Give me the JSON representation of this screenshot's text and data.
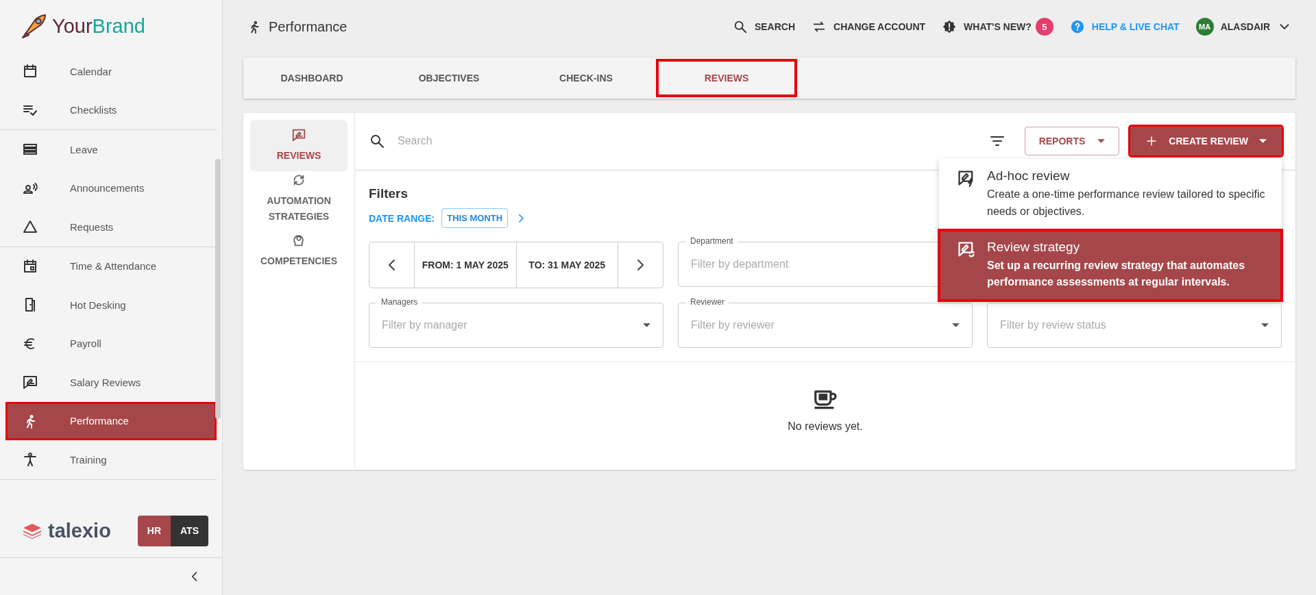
{
  "brand": {
    "part1": "Your",
    "part2": "Brand"
  },
  "sidebar": {
    "groups": [
      [
        {
          "label": "Calendar",
          "selected": false,
          "highlighted": false
        },
        {
          "label": "Checklists",
          "selected": false,
          "highlighted": false
        }
      ],
      [
        {
          "label": "Leave",
          "selected": false,
          "highlighted": false
        },
        {
          "label": "Announcements",
          "selected": false,
          "highlighted": false
        },
        {
          "label": "Requests",
          "selected": false,
          "highlighted": false
        }
      ],
      [
        {
          "label": "Time & Attendance",
          "selected": false,
          "highlighted": false
        },
        {
          "label": "Hot Desking",
          "selected": false,
          "highlighted": false
        },
        {
          "label": "Payroll",
          "selected": false,
          "highlighted": false
        },
        {
          "label": "Salary Reviews",
          "selected": false,
          "highlighted": false
        },
        {
          "label": "Performance",
          "selected": true,
          "highlighted": true
        },
        {
          "label": "Training",
          "selected": false,
          "highlighted": false
        }
      ]
    ],
    "footer": {
      "logo": "talexio",
      "modules": [
        {
          "label": "HR",
          "selected": true
        },
        {
          "label": "ATS",
          "selected": false
        }
      ]
    }
  },
  "header": {
    "title": "Performance",
    "search": "SEARCH",
    "change_account": "CHANGE ACCOUNT",
    "whats_new": "WHAT'S NEW?",
    "whats_new_count": "5",
    "help": "HELP & LIVE CHAT",
    "avatar": "MA",
    "user": "ALASDAIR"
  },
  "tabs": [
    {
      "label": "DASHBOARD",
      "selected": false,
      "highlighted": false
    },
    {
      "label": "OBJECTIVES",
      "selected": false,
      "highlighted": false
    },
    {
      "label": "CHECK-INS",
      "selected": false,
      "highlighted": false
    },
    {
      "label": "REVIEWS",
      "selected": true,
      "highlighted": true
    }
  ],
  "side_nav": [
    {
      "label": "REVIEWS",
      "selected": true
    },
    {
      "label": "AUTOMATION STRATEGIES",
      "selected": false
    },
    {
      "label": "COMPETENCIES",
      "selected": false
    }
  ],
  "toolbar": {
    "search_placeholder": "Search",
    "reports": "REPORTS",
    "create": "CREATE REVIEW",
    "create_highlighted": true
  },
  "filters": {
    "title": "Filters",
    "date_range_label": "DATE RANGE:",
    "date_range_value": "THIS MONTH",
    "from": "FROM: 1 MAY 2025",
    "to": "TO: 31 MAY 2025",
    "fields": [
      {
        "label": "Department",
        "placeholder": "Filter by department"
      },
      {
        "label": "Managers",
        "placeholder": "Filter by manager",
        "dropdown": true
      },
      {
        "label": "Reviewer",
        "placeholder": "Filter by reviewer",
        "dropdown": true
      },
      {
        "placeholder": "Filter by review status",
        "dropdown": true
      }
    ]
  },
  "empty_state": "No reviews yet.",
  "create_menu": [
    {
      "title": "Ad-hoc review",
      "description": "Create a one-time performance review tailored to specific needs or objectives.",
      "selected": false,
      "highlighted": false
    },
    {
      "title": "Review strategy",
      "description": "Set up a recurring review strategy that automates performance assessments at regular intervals.",
      "selected": true,
      "highlighted": true
    }
  ]
}
